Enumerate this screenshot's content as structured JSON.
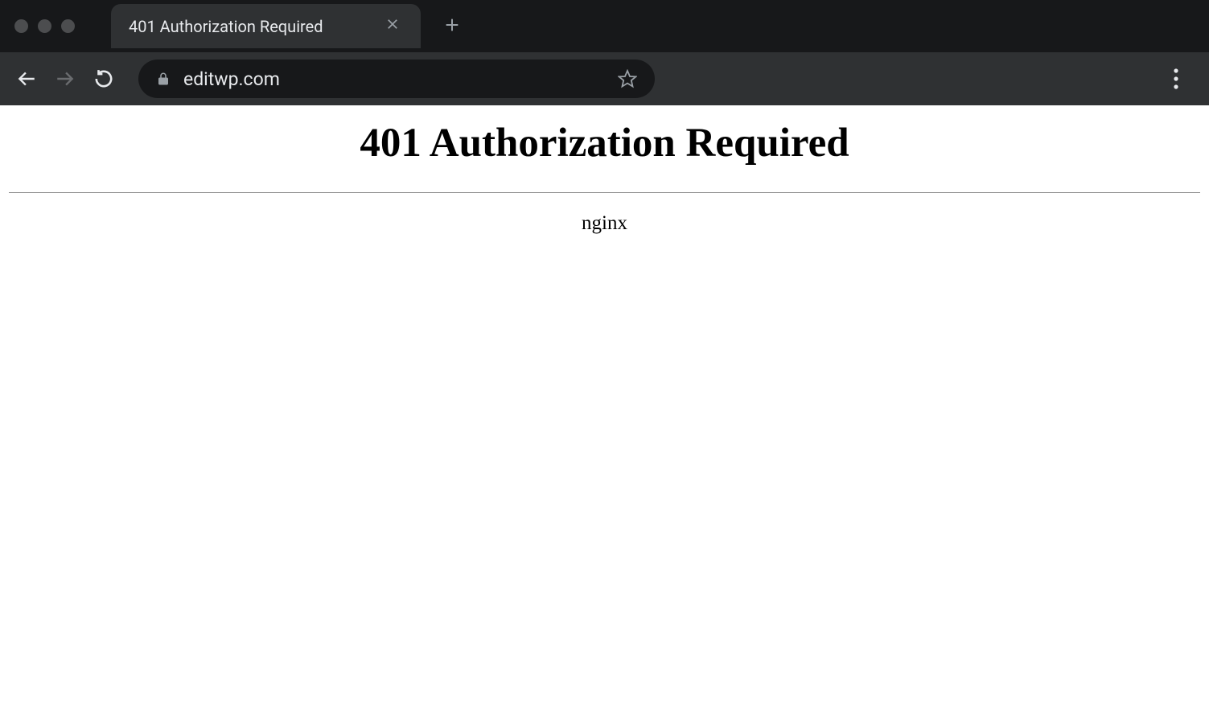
{
  "browser": {
    "tab": {
      "title": "401 Authorization Required"
    },
    "url": "editwp.com"
  },
  "page": {
    "heading": "401 Authorization Required",
    "server": "nginx"
  }
}
